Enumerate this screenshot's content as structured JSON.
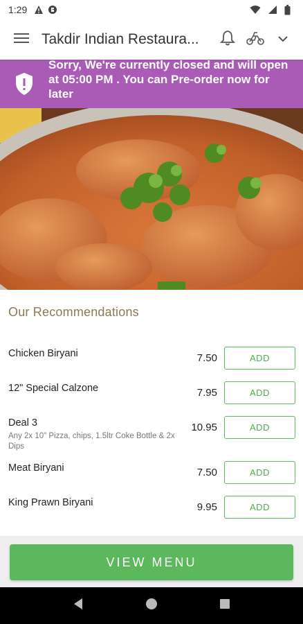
{
  "status_bar": {
    "time": "1:29",
    "icons": [
      "warning-icon",
      "data-saver-icon",
      "wifi-icon",
      "signal-icon",
      "battery-icon"
    ]
  },
  "app_bar": {
    "title": "Takdir Indian Restaura...",
    "icons": [
      "menu-icon",
      "bell-icon",
      "delivery-icon",
      "chevron-down-icon"
    ]
  },
  "banner": {
    "icon": "shield-alert-icon",
    "text": "Sorry, We're currently closed and will open at 05:00 PM . You can Pre-order now for later",
    "color": "#a95bb5"
  },
  "hero": {
    "icon": "food-photo"
  },
  "recommendations": {
    "title": "Our Recommendations",
    "items": [
      {
        "name": "Chicken Biryani",
        "description": "",
        "price": "7.50",
        "button": "ADD"
      },
      {
        "name": "12\" Special Calzone",
        "description": "",
        "price": "7.95",
        "button": "ADD"
      },
      {
        "name": "Deal 3",
        "description": "Any 2x 10\" Pizza, chips, 1.5ltr Coke Bottle & 2x Dips",
        "price": "10.95",
        "button": "ADD"
      },
      {
        "name": "Meat Biryani",
        "description": "",
        "price": "7.50",
        "button": "ADD"
      },
      {
        "name": "King Prawn Biryani",
        "description": "",
        "price": "9.95",
        "button": "ADD"
      }
    ]
  },
  "view_menu": {
    "label": "VIEW MENU",
    "color": "#5cb85c"
  },
  "nav_bar": {
    "icons": [
      "back-icon",
      "home-icon",
      "recents-icon"
    ]
  }
}
